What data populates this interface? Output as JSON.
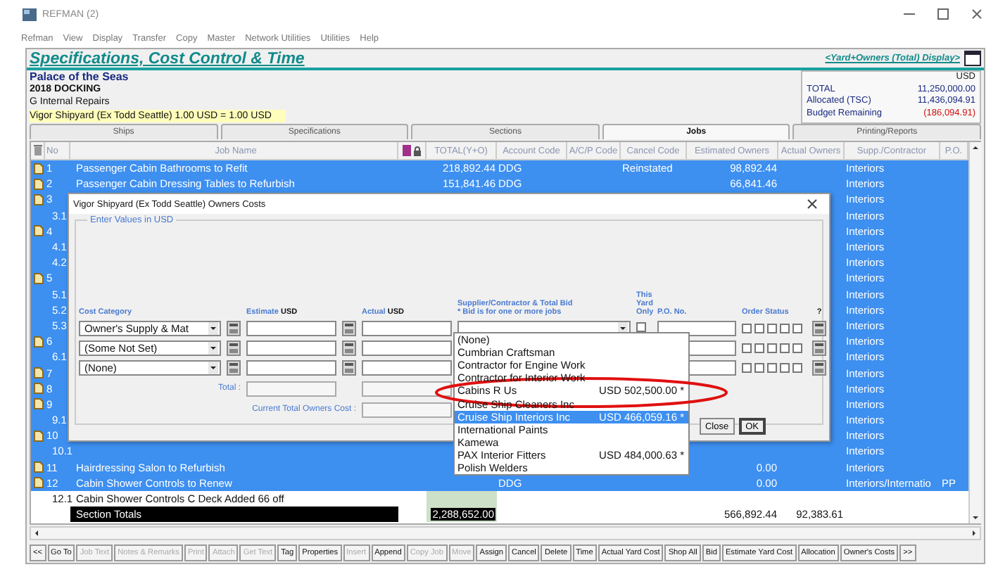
{
  "window": {
    "title": "REFMAN (2)"
  },
  "menu": [
    "Refman",
    "View",
    "Display",
    "Transfer",
    "Copy",
    "Master",
    "Network Utilities",
    "Utilities",
    "Help"
  ],
  "header": {
    "title": "Specifications, Cost Control & Time",
    "display_mode": "<Yard+Owners (Total) Display>"
  },
  "info": {
    "ship": "Palace of the Seas",
    "docking": "2018 DOCKING",
    "section": "G Internal Repairs",
    "shipyard": "Vigor Shipyard (Ex Todd Seattle) 1.00 USD = 1.00 USD"
  },
  "budget": {
    "currency": "USD",
    "rows": [
      {
        "label": "TOTAL",
        "value": "11,250,000.00",
        "negative": false
      },
      {
        "label": "Allocated (TSC)",
        "value": "11,436,094.91",
        "negative": false
      },
      {
        "label": "Budget Remaining",
        "value": "(186,094.91)",
        "negative": true
      }
    ]
  },
  "tabs": [
    {
      "label": "Ships",
      "selected": false
    },
    {
      "label": "Specifications",
      "selected": false
    },
    {
      "label": "Sections",
      "selected": false
    },
    {
      "label": "Jobs",
      "selected": true
    },
    {
      "label": "Printing/Reports",
      "selected": false
    }
  ],
  "table": {
    "columns": [
      "No",
      "Job Name",
      "TOTAL(Y+O)",
      "Account Code",
      "A/C/P Code",
      "Cancel Code",
      "Estimated Owners",
      "Actual Owners",
      "Supp./Contractor",
      "P.O."
    ],
    "rows": [
      {
        "no": "1",
        "doc": true,
        "selected": true,
        "name": "Passenger Cabin Bathrooms to Refit",
        "total": "218,892.44",
        "account": "DDG",
        "cancel": "Reinstated",
        "est": "98,892.44",
        "supplier": "Interiors"
      },
      {
        "no": "2",
        "doc": true,
        "selected": true,
        "name": "Passenger Cabin Dressing Tables to Refurbish",
        "total": "151,841.46",
        "account": "DDG",
        "est": "66,841.46",
        "supplier": "Interiors"
      },
      {
        "no": "3",
        "doc": true,
        "selected": true,
        "supplier": "Interiors"
      },
      {
        "no": "3.1",
        "doc": false,
        "selected": true,
        "supplier": "Interiors"
      },
      {
        "no": "4",
        "doc": true,
        "selected": true,
        "supplier": "Interiors"
      },
      {
        "no": "4.1",
        "doc": false,
        "selected": true,
        "supplier": "Interiors"
      },
      {
        "no": "4.2",
        "doc": false,
        "selected": true,
        "supplier": "Interiors"
      },
      {
        "no": "5",
        "doc": true,
        "selected": true,
        "supplier": "Interiors"
      },
      {
        "no": "5.1",
        "doc": false,
        "selected": true,
        "supplier": "Interiors"
      },
      {
        "no": "5.2",
        "doc": false,
        "selected": true,
        "supplier": "Interiors"
      },
      {
        "no": "5.3",
        "doc": false,
        "selected": true,
        "supplier": "Interiors"
      },
      {
        "no": "6",
        "doc": true,
        "selected": true,
        "supplier": "Interiors"
      },
      {
        "no": "6.1",
        "doc": false,
        "selected": true,
        "supplier": "Interiors"
      },
      {
        "no": "7",
        "doc": true,
        "selected": true,
        "supplier": "Interiors"
      },
      {
        "no": "8",
        "doc": true,
        "selected": true,
        "supplier": "Interiors"
      },
      {
        "no": "9",
        "doc": true,
        "selected": true,
        "supplier": "Interiors"
      },
      {
        "no": "9.1",
        "doc": false,
        "selected": true,
        "supplier": "Interiors"
      },
      {
        "no": "10",
        "doc": true,
        "selected": true,
        "supplier": "Interiors"
      },
      {
        "no": "10.1",
        "doc": false,
        "selected": true,
        "supplier": "Interiors"
      },
      {
        "no": "11",
        "doc": true,
        "selected": true,
        "name": "Hairdressing Salon to Refurbish",
        "est": "0.00",
        "supplier": "Interiors"
      },
      {
        "no": "12",
        "doc": true,
        "selected": true,
        "name": "Cabin Shower Controls to Renew",
        "account": "DDG",
        "est": "0.00",
        "supplier": "Interiors/Internatio",
        "po": "PP"
      },
      {
        "no": "12.1",
        "doc": false,
        "selected": false,
        "name": "Cabin Shower Controls C Deck Added 66 off"
      }
    ],
    "totals": {
      "label": "Section Totals",
      "total": "2,288,652.00",
      "est": "566,892.44",
      "act": "92,383.61"
    }
  },
  "dialog": {
    "title": "Vigor Shipyard (Ex Todd Seattle) Owners Costs",
    "group": "Enter Values in USD",
    "headers": {
      "category": "Cost Category",
      "estimate": "Estimate",
      "estimate_unit": "USD",
      "actual": "Actual",
      "actual_unit": "USD",
      "supplier": "Supplier/Contractor & Total Bid",
      "supplier_note": "* Bid is for one or more jobs",
      "yard_only": "This Yard Only",
      "po": "P.O. No.",
      "order_status": "Order Status",
      "help": "?"
    },
    "lines": [
      {
        "category": "Owner's Supply & Mat",
        "yard_only_checked": false,
        "status": [
          false,
          false,
          false,
          false,
          false
        ]
      },
      {
        "category": "(Some Not Set)",
        "status": [
          false,
          false,
          false,
          false,
          false
        ]
      },
      {
        "category": "(None)",
        "status": [
          false,
          false,
          false,
          false,
          false
        ]
      }
    ],
    "total_label": "Total :",
    "current_total_label": "Current Total Owners Cost :",
    "buttons": [
      "Close",
      "OK"
    ],
    "supplier_list": [
      {
        "name": "(None)",
        "selected": false
      },
      {
        "name": "Cumbrian Craftsman",
        "selected": false
      },
      {
        "name": "Contractor for Engine Work",
        "selected": false
      },
      {
        "name": "Contractor for Interior Work",
        "selected": false
      },
      {
        "name": "Cabins R Us",
        "bid": "USD 502,500.00 *",
        "selected": false
      },
      {
        "name": "Cruise Ship Cleaners Inc",
        "selected": false
      },
      {
        "name": "Cruise Ship Interiors Inc",
        "bid": "USD 466,059.16 *",
        "selected": true
      },
      {
        "name": "International Paints",
        "selected": false
      },
      {
        "name": "Kamewa",
        "selected": false
      },
      {
        "name": "PAX Interior Fitters",
        "bid": "USD 484,000.63 *",
        "selected": false
      },
      {
        "name": "Polish Welders",
        "selected": false
      }
    ]
  },
  "toolbar": [
    {
      "label": "<<",
      "disabled": false
    },
    {
      "label": "Go To",
      "disabled": false
    },
    {
      "label": "Job Text",
      "disabled": true
    },
    {
      "label": "Notes & Remarks",
      "disabled": true
    },
    {
      "label": "Print",
      "disabled": true
    },
    {
      "label": "Attach",
      "disabled": true
    },
    {
      "label": "Get Text",
      "disabled": true
    },
    {
      "label": "Tag",
      "disabled": false
    },
    {
      "label": "Properties",
      "disabled": false
    },
    {
      "label": "Insert",
      "disabled": true
    },
    {
      "label": "Append",
      "disabled": false
    },
    {
      "label": "Copy Job",
      "disabled": true
    },
    {
      "label": "Move",
      "disabled": true
    },
    {
      "label": "Assign",
      "disabled": false
    },
    {
      "label": "Cancel",
      "disabled": false
    },
    {
      "label": "Delete",
      "disabled": false
    },
    {
      "label": "Time",
      "disabled": false
    },
    {
      "label": "Actual Yard Cost",
      "disabled": false
    },
    {
      "label": "Shop All",
      "disabled": false
    },
    {
      "label": "Bid",
      "disabled": false
    },
    {
      "label": "Estimate Yard Cost",
      "disabled": false
    },
    {
      "label": "Allocation",
      "disabled": false
    },
    {
      "label": "Owner's Costs",
      "disabled": false
    },
    {
      "label": ">>",
      "disabled": false
    }
  ]
}
